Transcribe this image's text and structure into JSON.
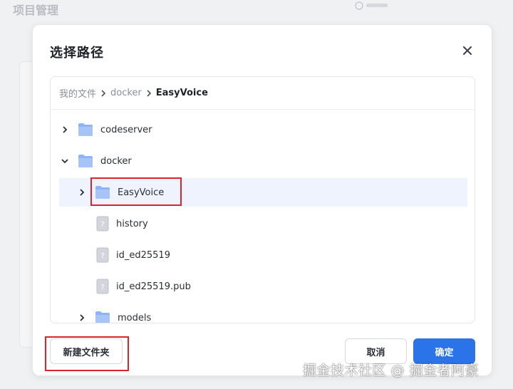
{
  "background": {
    "page_title": "项目管理"
  },
  "dialog": {
    "title": "选择路径",
    "breadcrumb": [
      {
        "label": "我的文件",
        "current": false
      },
      {
        "label": "docker",
        "current": false
      },
      {
        "label": "EasyVoice",
        "current": true
      }
    ],
    "tree": [
      {
        "label": "codeserver",
        "type": "folder",
        "expanded": false,
        "level": 0
      },
      {
        "label": "docker",
        "type": "folder",
        "expanded": true,
        "level": 0
      },
      {
        "label": "EasyVoice",
        "type": "folder",
        "expanded": false,
        "level": 1,
        "selected": true
      },
      {
        "label": "history",
        "type": "file",
        "level": 1
      },
      {
        "label": "id_ed25519",
        "type": "file",
        "level": 1
      },
      {
        "label": "id_ed25519.pub",
        "type": "file",
        "level": 1
      },
      {
        "label": "models",
        "type": "folder",
        "expanded": false,
        "level": 1
      }
    ],
    "buttons": {
      "new_folder": "新建文件夹",
      "cancel": "取消",
      "confirm": "确定"
    }
  },
  "watermark": "掘金技术社区 @ 掘金者阿豪",
  "colors": {
    "primary": "#2b73e8",
    "selected_row": "#eef3fd",
    "folder": "#8fb4f5",
    "annotation_red": "#d9262e"
  }
}
